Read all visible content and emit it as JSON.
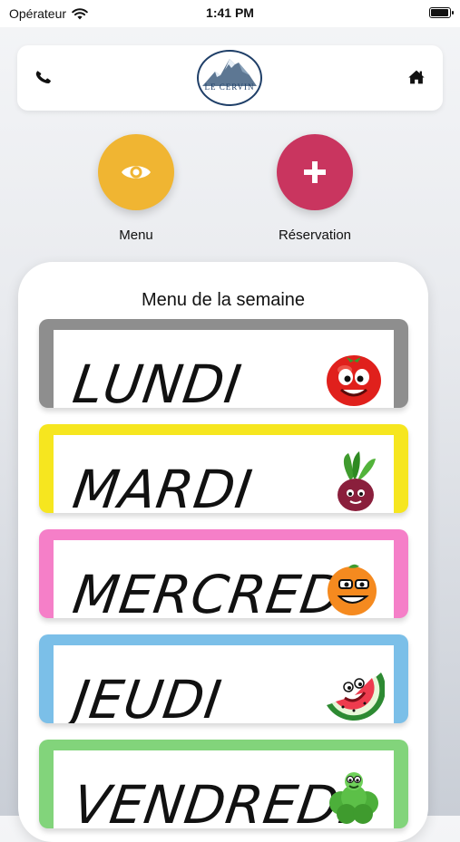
{
  "status": {
    "carrier": "Opérateur",
    "time": "1:41 PM",
    "battery_level": 0.95
  },
  "header": {
    "logo_text": "LE CERVIN",
    "phone_icon": "phone-icon",
    "home_icon": "home-icon"
  },
  "actions": {
    "menu_label": "Menu",
    "menu_icon": "eye-icon",
    "reservation_label": "Réservation",
    "reservation_icon": "plus-icon"
  },
  "week": {
    "title": "Menu de la semaine",
    "days": [
      {
        "label": "LUNDI",
        "color": "#8e8e8e",
        "emoji": "tomato"
      },
      {
        "label": "MARDI",
        "color": "#f6e61f",
        "emoji": "beet"
      },
      {
        "label": "MERCREDI",
        "color": "#f57fc8",
        "emoji": "orange"
      },
      {
        "label": "JEUDI",
        "color": "#7bbfe8",
        "emoji": "watermelon"
      },
      {
        "label": "VENDREDI",
        "color": "#82d47b",
        "emoji": "broccoli"
      }
    ]
  },
  "colors": {
    "menu_button": "#f0b532",
    "reservation_button": "#c9355f"
  }
}
